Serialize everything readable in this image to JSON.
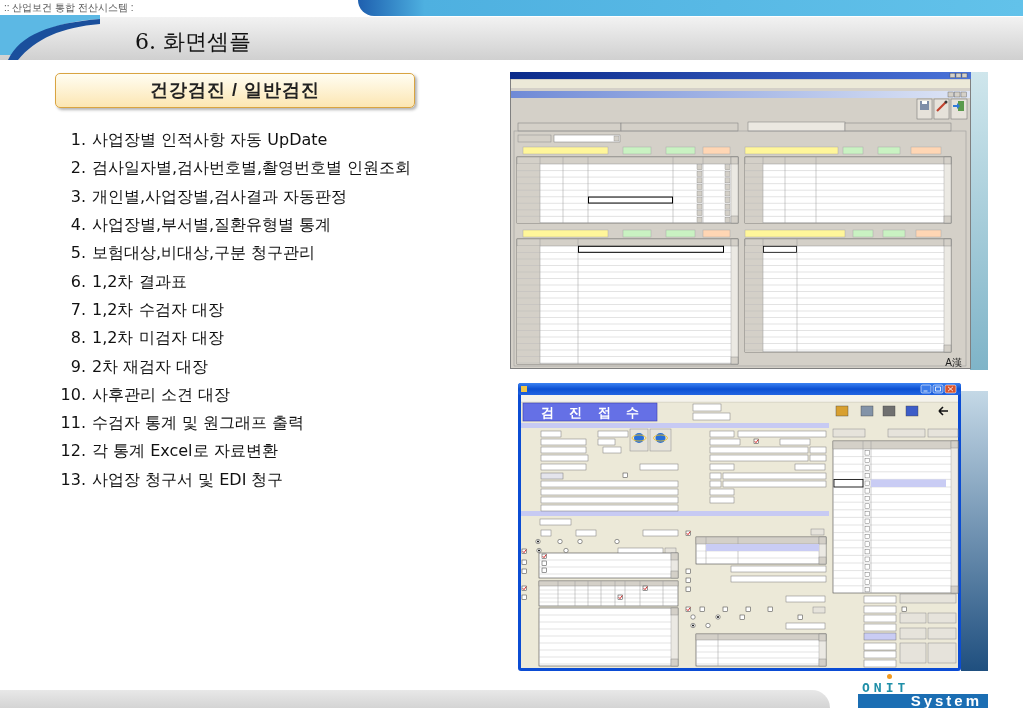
{
  "header": {
    "system_name": ":: 산업보건 통합 전산시스템 :",
    "section_title": "6. 화면셈플"
  },
  "feature_box": {
    "title": "건강검진 / 일반검진"
  },
  "features": [
    {
      "number": "1.",
      "text": "사업장별 인적사항 자동 UpDate"
    },
    {
      "number": "2.",
      "text": "검사일자별,검사번호별,촬영번호별 인원조회"
    },
    {
      "number": "3.",
      "text": "개인별,사업장별,검사결과 자동판정"
    },
    {
      "number": "4.",
      "text": "사업장별,부서별,질환유형별 통계"
    },
    {
      "number": "5.",
      "text": "보험대상,비대상,구분 청구관리"
    },
    {
      "number": "6.",
      "text": "1,2차 결과표"
    },
    {
      "number": "7.",
      "text": "1,2차 수검자 대장"
    },
    {
      "number": "8.",
      "text": "1,2차 미검자 대장"
    },
    {
      "number": "9.",
      "text": "2차 재검자 대장"
    },
    {
      "number": "10.",
      "text": "사후관리 소견 대장"
    },
    {
      "number": "11.",
      "text": "수검자 통계 및 원그래프 출력"
    },
    {
      "number": "12.",
      "text": "각 통계 Excel로 자료변환"
    },
    {
      "number": "13.",
      "text": "사업장 청구서 및 EDI 청구"
    }
  ],
  "screenshots": [
    {
      "kind": "code_window",
      "ime_indicator": "A漢"
    },
    {
      "kind": "reception_window",
      "banner": "검 진 접 수"
    }
  ],
  "logo": {
    "wordmark": "ONIT",
    "tagline": "System"
  }
}
